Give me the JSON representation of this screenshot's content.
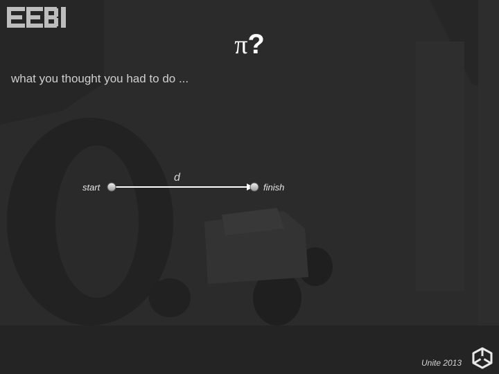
{
  "slide": {
    "logo_text": "EEBI",
    "title_symbol": "π",
    "title_mark": "?",
    "subtitle": "what you thought you had to do ..."
  },
  "diagram": {
    "start_label": "start",
    "finish_label": "finish",
    "edge_label": "d"
  },
  "footer": {
    "conference": "Unite 2013",
    "logo_icon": "unity-logo-icon"
  },
  "colors": {
    "background": "#262626",
    "text": "#ffffff",
    "muted_text": "#cfcfcf",
    "node_fill": "#cccccc"
  }
}
